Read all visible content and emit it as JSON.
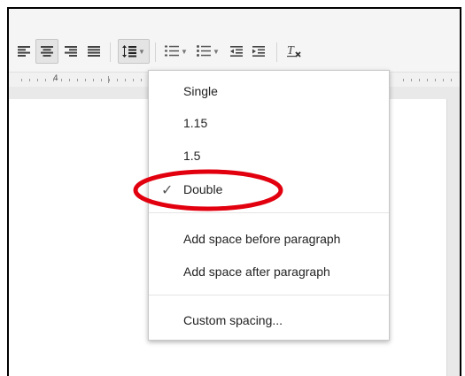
{
  "toolbar": {
    "buttons": [
      {
        "name": "align-left-icon"
      },
      {
        "name": "align-center-icon",
        "active": true
      },
      {
        "name": "align-right-icon"
      },
      {
        "name": "align-justify-icon"
      },
      {
        "name": "line-spacing-icon",
        "active": true,
        "has_dropdown": true
      },
      {
        "name": "numbered-list-icon",
        "has_dropdown": true
      },
      {
        "name": "bulleted-list-icon",
        "has_dropdown": true
      },
      {
        "name": "decrease-indent-icon"
      },
      {
        "name": "increase-indent-icon"
      },
      {
        "name": "clear-formatting-icon"
      }
    ]
  },
  "ruler": {
    "number": "4"
  },
  "line_spacing_menu": {
    "options": [
      "Single",
      "1.15",
      "1.5",
      "Double"
    ],
    "selected": "Double",
    "paragraph_options": [
      "Add space before paragraph",
      "Add space after paragraph"
    ],
    "custom": "Custom spacing..."
  },
  "annotation": {
    "color": "#e2000f",
    "target": "Double"
  },
  "colors": {
    "toolbar_bg": "#f5f5f5",
    "menu_border": "#c8c8c8",
    "canvas_bg": "#e9e9e9"
  }
}
